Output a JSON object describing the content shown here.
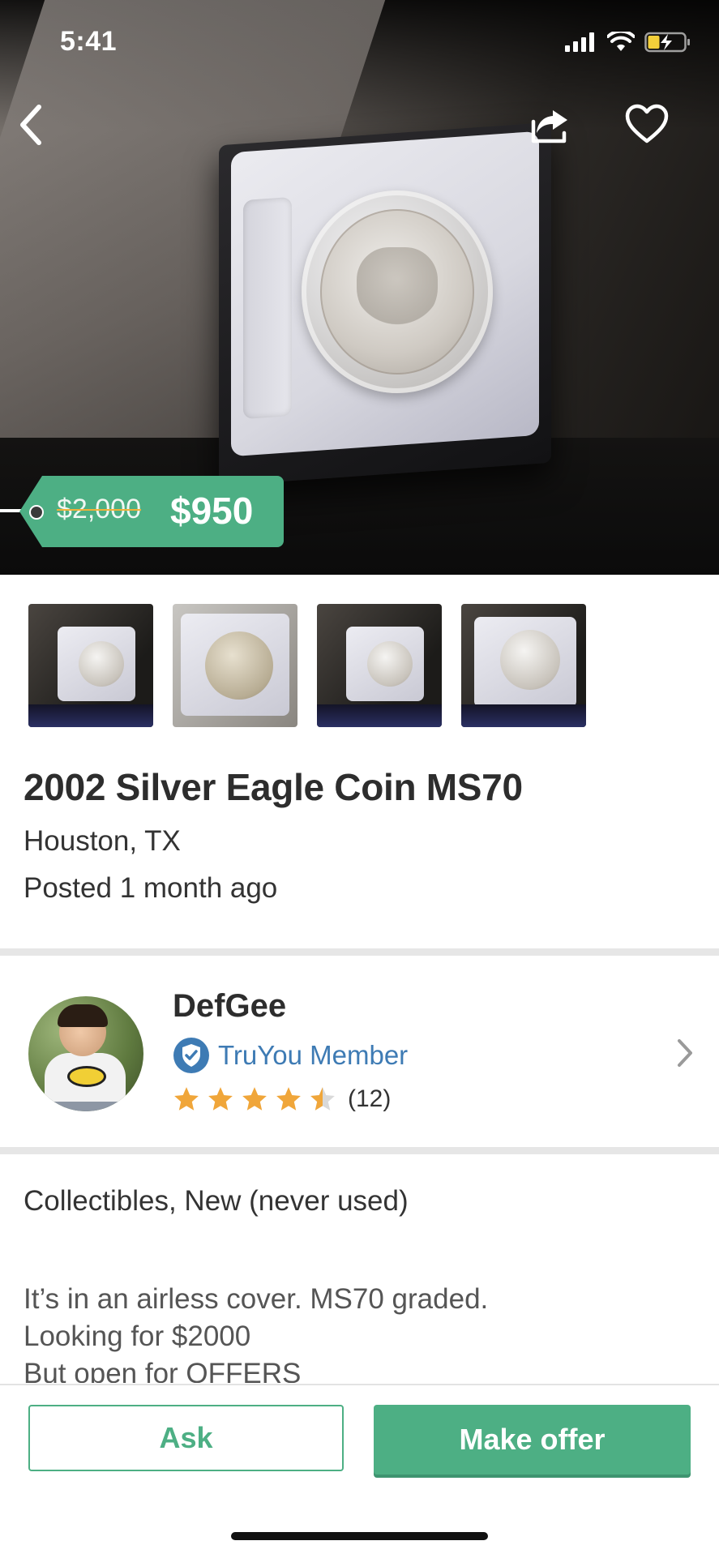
{
  "status_bar": {
    "time": "5:41"
  },
  "hero": {
    "old_price": "$2,000",
    "new_price": "$950"
  },
  "thumbnails": [
    "thumb-1",
    "thumb-2",
    "thumb-3",
    "thumb-4"
  ],
  "listing": {
    "title": "2002 Silver Eagle Coin MS70",
    "location": "Houston, TX",
    "posted": "Posted 1 month ago",
    "condition": "Collectibles, New (never used)",
    "description": [
      "It’s in an airless cover. MS70 graded.",
      "Looking for $2000",
      "But open for OFFERS"
    ]
  },
  "seller": {
    "name": "DefGee",
    "badge": "TruYou Member",
    "rating": 4.5,
    "rating_count": "(12)"
  },
  "actions": {
    "ask": "Ask",
    "make_offer": "Make offer"
  },
  "colors": {
    "accent": "#4daf84",
    "badge_blue": "#3e7bb4",
    "star": "#f0a63a"
  }
}
